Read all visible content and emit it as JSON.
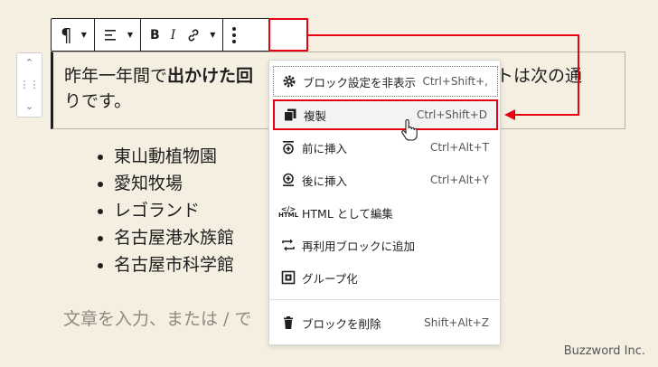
{
  "toolbar": {
    "paragraph_icon": "pilcrow-icon",
    "align_icon": "align-left-icon",
    "bold_label": "B",
    "italic_label": "I",
    "link_icon": "link-icon",
    "more_icon": "vertical-ellipsis-icon"
  },
  "paragraph": {
    "text_before": "昨年一年間で",
    "text_bold": "出かけた回",
    "text_after": "ットは次の通",
    "text_line2": "りです。"
  },
  "list": {
    "items": [
      "東山動植物園",
      "愛知牧場",
      "レゴランド",
      "名古屋港水族館",
      "名古屋市科学館"
    ]
  },
  "placeholder": "文章を入力、または / で",
  "menu": {
    "items": [
      {
        "label": "ブロック設定を非表示",
        "shortcut": "Ctrl+Shift+,",
        "icon": "gear-icon"
      },
      {
        "label": "複製",
        "shortcut": "Ctrl+Shift+D",
        "icon": "duplicate-icon"
      },
      {
        "label": "前に挿入",
        "shortcut": "Ctrl+Alt+T",
        "icon": "insert-before-icon"
      },
      {
        "label": "後に挿入",
        "shortcut": "Ctrl+Alt+Y",
        "icon": "insert-after-icon"
      },
      {
        "label": "HTML として編集",
        "shortcut": "",
        "icon": "html-icon"
      },
      {
        "label": "再利用ブロックに追加",
        "shortcut": "",
        "icon": "reusable-block-icon"
      },
      {
        "label": "グループ化",
        "shortcut": "",
        "icon": "group-icon"
      },
      {
        "label": "ブロックを削除",
        "shortcut": "Shift+Alt+Z",
        "icon": "trash-icon"
      }
    ],
    "html_icon_text": "HTML"
  },
  "colors": {
    "highlight": "#e60012",
    "background": "#f4efe1"
  },
  "watermark": "Buzzword Inc."
}
